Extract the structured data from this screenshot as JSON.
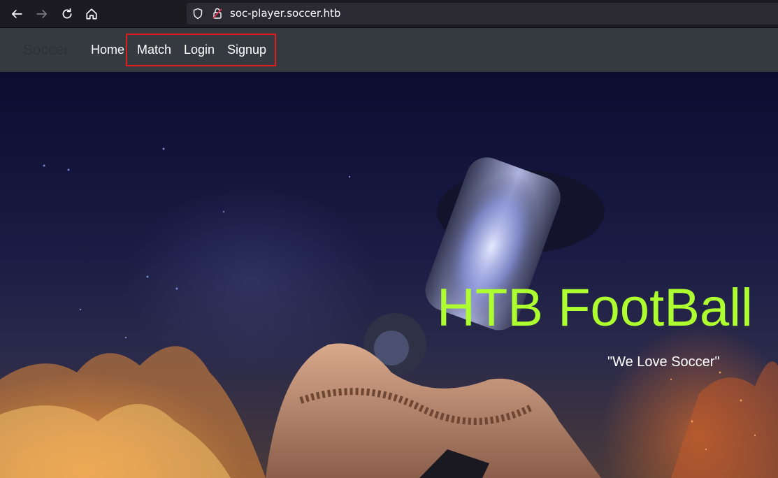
{
  "browser": {
    "url": "soc-player.soccer.htb"
  },
  "site_nav": {
    "brand": "Soccer",
    "links": [
      "Home",
      "Match",
      "Login",
      "Signup"
    ]
  },
  "hero": {
    "title": "HTB FootBall",
    "subtitle": "\"We Love Soccer\""
  },
  "colors": {
    "navbar_bg": "#343a40",
    "title_color": "#adff2f",
    "highlight_border": "#e01e1e"
  }
}
